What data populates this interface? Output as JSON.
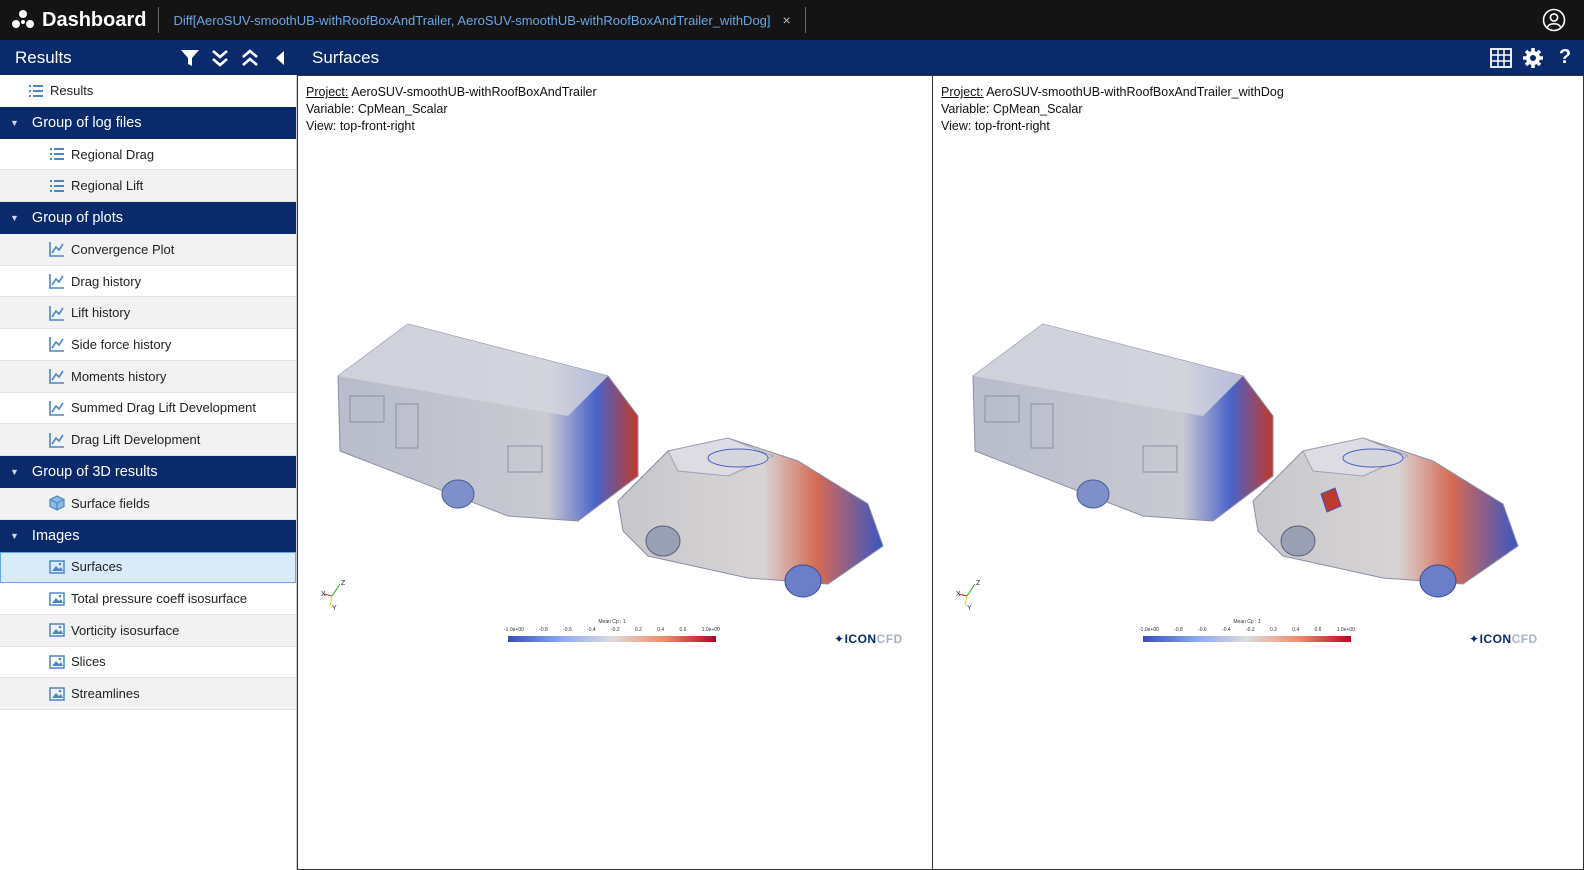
{
  "topbar": {
    "app_title": "Dashboard",
    "tab_label": "Diff[AeroSUV-smoothUB-withRoofBoxAndTrailer, AeroSUV-smoothUB-withRoofBoxAndTrailer_withDog]",
    "tab_close": "×"
  },
  "subbar": {
    "left_title": "Results",
    "main_title": "Surfaces"
  },
  "sidebar": {
    "root": "Results",
    "groups": [
      {
        "label": "Group of log files",
        "items": [
          "Regional Drag",
          "Regional Lift"
        ]
      },
      {
        "label": "Group of plots",
        "items": [
          "Convergence Plot",
          "Drag history",
          "Lift history",
          "Side force history",
          "Moments history",
          "Summed Drag Lift Development",
          "Drag Lift Development"
        ]
      },
      {
        "label": "Group of 3D results",
        "items": [
          "Surface fields"
        ]
      },
      {
        "label": "Images",
        "items": [
          "Surfaces",
          "Total pressure coeff isosurface",
          "Vorticity isosurface",
          "Slices",
          "Streamlines"
        ]
      }
    ],
    "selected": "Surfaces"
  },
  "panels": [
    {
      "project_label": "Project:",
      "project": "AeroSUV-smoothUB-withRoofBoxAndTrailer",
      "variable": "Variable: CpMean_Scalar",
      "view": "View: top-front-right"
    },
    {
      "project_label": "Project:",
      "project": "AeroSUV-smoothUB-withRoofBoxAndTrailer_withDog",
      "variable": "Variable: CpMean_Scalar",
      "view": "View: top-front-right"
    }
  ],
  "legend": {
    "title": "Mean Cp : 1",
    "ticks": [
      "-1.0e+00",
      "-0.8",
      "-0.6",
      "-0.4",
      "-0.2",
      "0.2",
      "0.4",
      "0.6",
      "1.0e+00"
    ]
  },
  "brand": {
    "icon": "ICON",
    "cfd": "CFD"
  },
  "colors": {
    "navy": "#0a2a6b",
    "topbar": "#141414",
    "accent": "#6aa6e8"
  }
}
